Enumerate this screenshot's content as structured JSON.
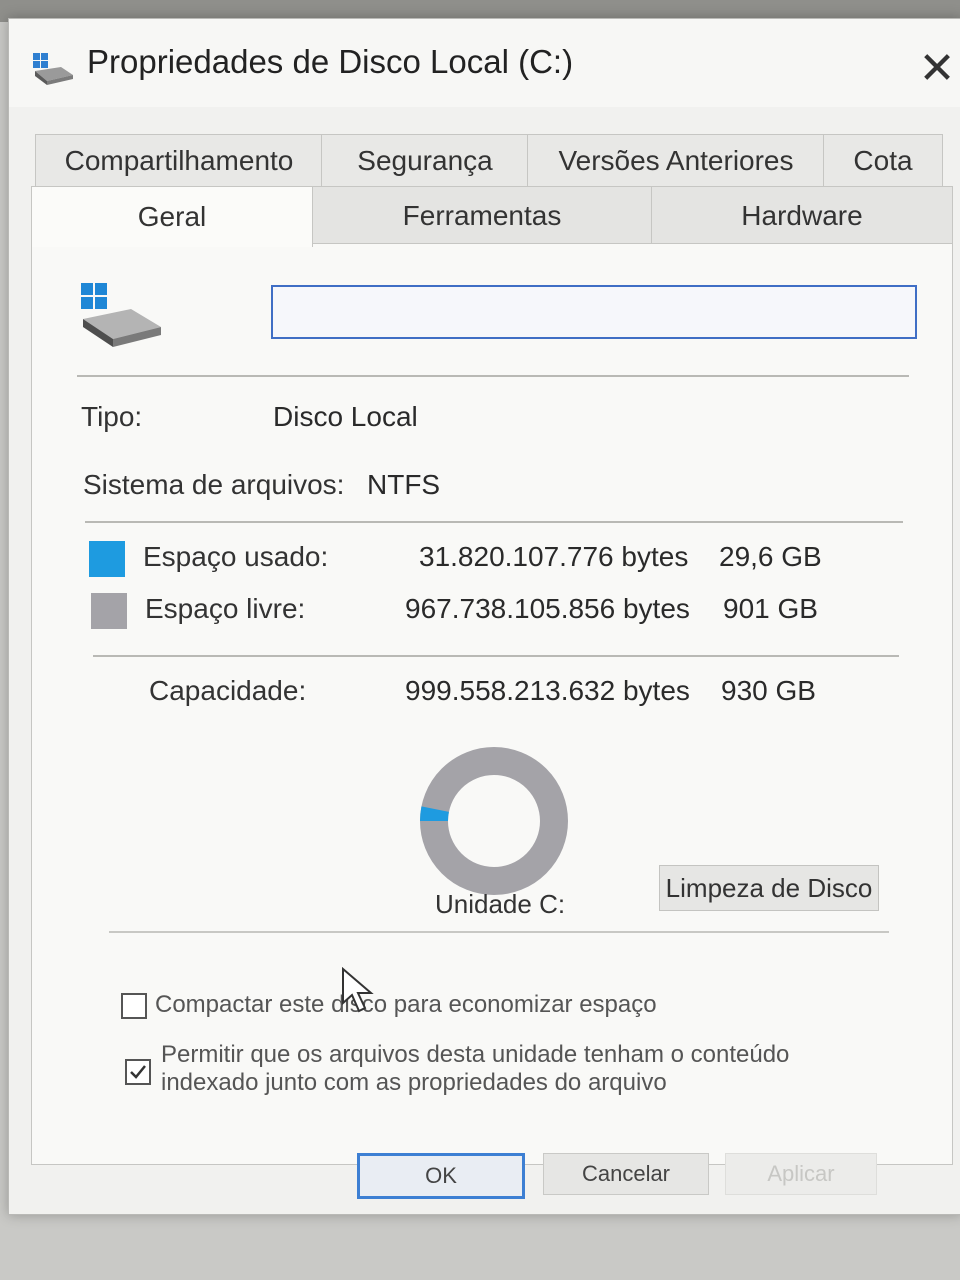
{
  "window": {
    "title": "Propriedades de Disco Local (C:)",
    "close_symbol": "✕",
    "icon": "drive-icon"
  },
  "tabs": {
    "row1": [
      "Compartilhamento",
      "Segurança",
      "Versões Anteriores",
      "Cota"
    ],
    "row2": [
      "Geral",
      "Ferramentas",
      "Hardware"
    ],
    "active": "Geral"
  },
  "general": {
    "volume_label_value": "",
    "type_label": "Tipo:",
    "type_value": "Disco Local",
    "fs_label": "Sistema de arquivos:",
    "fs_value": "NTFS",
    "used": {
      "label": "Espaço usado:",
      "bytes": "31.820.107.776 bytes",
      "size": "29,6 GB",
      "color": "#1e9be0"
    },
    "free": {
      "label": "Espaço livre:",
      "bytes": "967.738.105.856 bytes",
      "size": "901 GB",
      "color": "#a4a3a8"
    },
    "capacity": {
      "label": "Capacidade:",
      "bytes": "999.558.213.632 bytes",
      "size": "930 GB"
    },
    "drive_label": "Unidade C:",
    "cleanup_button": "Limpeza de Disco",
    "used_fraction": 0.0318
  },
  "options": {
    "compress": {
      "label": "Compactar este disco para economizar espaço",
      "checked": false
    },
    "index_line1": "Permitir que os arquivos desta unidade tenham o conteúdo",
    "index_line2": "indexado junto com as propriedades do arquivo",
    "index_checked": true
  },
  "buttons": {
    "ok": "OK",
    "cancel": "Cancelar",
    "apply": "Aplicar"
  }
}
